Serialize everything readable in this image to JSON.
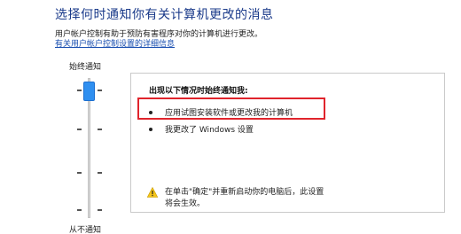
{
  "header": {
    "title": "选择何时通知你有关计算机更改的消息",
    "description": "用户帐户控制有助于预防有害程序对你的计算机进行更改。",
    "link": "有关用户帐户控制设置的详细信息"
  },
  "slider": {
    "top_label": "始终通知",
    "bottom_label": "从不通知",
    "level": "始终通知"
  },
  "info_panel": {
    "heading": "出现以下情况时始终通知我:",
    "items": [
      "应用试图安装软件或更改我的计算机",
      "我更改了 Windows 设置"
    ],
    "warning": "在单击\"确定\"并重新启动你的电脑后，此设置将会生效。"
  },
  "colors": {
    "title": "#1a3a8a",
    "link": "#1a4fb0",
    "thumb": "#2f8ff0",
    "highlight": "#e0242c"
  },
  "icons": {
    "warning": "warning-triangle-icon"
  }
}
